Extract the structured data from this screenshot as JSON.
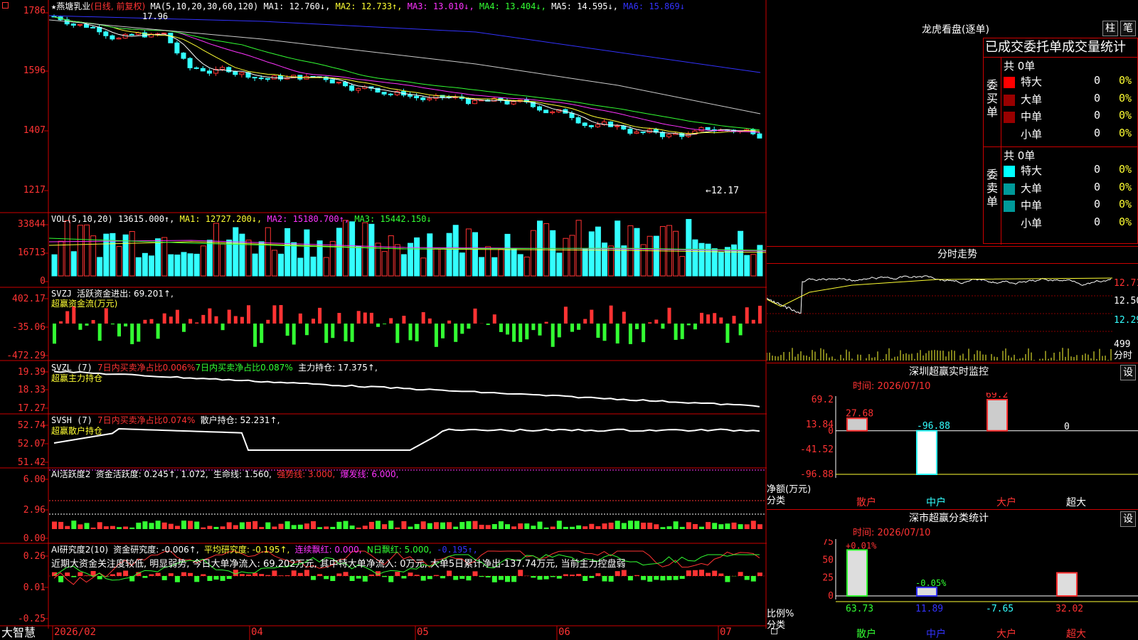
{
  "stock": {
    "star": "★",
    "name": "燕塘乳业",
    "mode": "(日线, 前复权)",
    "price_high_mark": "17.96",
    "price_low_mark": "←12.17"
  },
  "ma_bar": {
    "label": "MA(5,10,20,30,60,120)",
    "ma1": "MA1: 12.760↓,",
    "ma2": "MA2: 12.733↑,",
    "ma3": "MA3: 13.010↓,",
    "ma4": "MA4: 13.404↓,",
    "ma5": "MA5: 14.595↓,",
    "ma6": "MA6: 15.869↓"
  },
  "price_axis": [
    "1786",
    "1596",
    "1407",
    "1217"
  ],
  "vol": {
    "label": "VOL(5,10,20)",
    "value": "13615.000↑,",
    "ma1": "MA1: 12727.200↓,",
    "ma2": "MA2: 15180.700↑,",
    "ma3": "MA3: 15442.150↓",
    "axis": [
      "33844",
      "16713",
      "0"
    ]
  },
  "svzj": {
    "label": "SVZJ",
    "text": "活跃资金进出: 69.201↑,",
    "sub": "超赢资金流(万元)",
    "axis": [
      "402.17",
      "-35.06",
      "-472.29"
    ]
  },
  "svzl": {
    "label": "SVZL (7)",
    "t1": "7日内买卖净占比0.006%",
    "t2": "7日内买卖净占比0.087%",
    "t3": "主力持仓: 17.375↑,",
    "sub": "超赢主力持仓",
    "axis": [
      "19.39",
      "18.33",
      "17.27"
    ]
  },
  "svsh": {
    "label": "SVSH (7)",
    "t1": "7日内买卖净占比0.074%",
    "t2": "散户持仓: 52.231↑,",
    "sub": "超赢散户持仓",
    "axis": [
      "52.74",
      "52.07",
      "51.42"
    ]
  },
  "ai2": {
    "label": "AI活跃度2",
    "t1": "资金活跃度: 0.245↑, 1.072,",
    "t2": "生命线: 1.560,",
    "t3": "强势线: 3.000,",
    "t4": "爆发线: 6.000,",
    "axis": [
      "6.00",
      "2.96",
      "0.00"
    ]
  },
  "ai_research": {
    "label": "AI研究度2(10)",
    "t1": "资金研究度: -0.006↑,",
    "t2": "平均研究度: -0.195↑,",
    "t3": "连续飘红: 0.000,",
    "t4": "N日飘红: 5.000,",
    "t5": "-0.195↑,",
    "desc": "近期大资金关注度较低, 明显弱势, 今日大单净流入: 69.202万元, 其中特大单净流入: 0万元, 大单5日累计净出-137.74万元, 当前主力控盘弱",
    "axis": [
      "0.26",
      "0.01",
      "-0.25"
    ]
  },
  "bottom": {
    "logo": "大智慧",
    "dates": [
      "2026/02",
      "04",
      "05",
      "06",
      "07"
    ]
  },
  "right_top": {
    "title": "龙虎看盘(逐单)",
    "btn1": "柱",
    "btn2": "笔",
    "header": "已成交委托单成交量统计",
    "buy_label": "委买单",
    "sell_label": "委卖单",
    "buy_total": "共 0单",
    "sell_total": "共 0单",
    "rows": [
      {
        "name": "特大",
        "val": "0",
        "pct": "0%"
      },
      {
        "name": "大单",
        "val": "0",
        "pct": "0%"
      },
      {
        "name": "中单",
        "val": "0",
        "pct": "0%"
      },
      {
        "name": "小单",
        "val": "0",
        "pct": "0%"
      }
    ],
    "buy_colors": [
      "#ff0000",
      "#990000",
      "#990000",
      "#000000"
    ],
    "sell_colors": [
      "#00ffff",
      "#009999",
      "#009999",
      "#000000"
    ]
  },
  "intraday": {
    "title": "分时走势",
    "axis": [
      "12.71",
      "12.50",
      "12.29"
    ],
    "vol_axis": [
      "499"
    ],
    "unit": "分时"
  },
  "szmon": {
    "title": "深圳超赢实时监控",
    "btn": "设",
    "time": "时间: 2026/07/10",
    "axis": [
      "69.2",
      "13.84",
      "0",
      "-41.52",
      "-96.88"
    ],
    "ylab1": "净额(万元)",
    "ylab2": "分类",
    "cats": [
      "散户",
      "中户",
      "大户",
      "超大"
    ],
    "chart_data": {
      "type": "bar",
      "categories": [
        "散户",
        "中户",
        "大户",
        "超大"
      ],
      "values": [
        27.68,
        -96.88,
        69.2,
        0
      ],
      "ylim": [
        -96.88,
        69.2
      ]
    }
  },
  "szcls": {
    "title": "深市超赢分类统计",
    "btn": "设",
    "time": "时间: 2026/07/10",
    "axis": [
      "75",
      "50",
      "25",
      "0"
    ],
    "ylab1": "比例%",
    "ylab2": "分类",
    "cats": [
      "散户",
      "中户",
      "大户",
      "超大"
    ],
    "top_labels": [
      "+0.01%",
      "-0.05%",
      "",
      ""
    ],
    "bottom_labels": [
      "63.73",
      "11.89",
      "-7.65",
      "32.02"
    ],
    "chart_data": {
      "type": "bar",
      "categories": [
        "散户",
        "中户",
        "大户",
        "超大"
      ],
      "values": [
        63.73,
        11.89,
        0,
        32.02
      ],
      "ylim": [
        0,
        75
      ]
    }
  }
}
